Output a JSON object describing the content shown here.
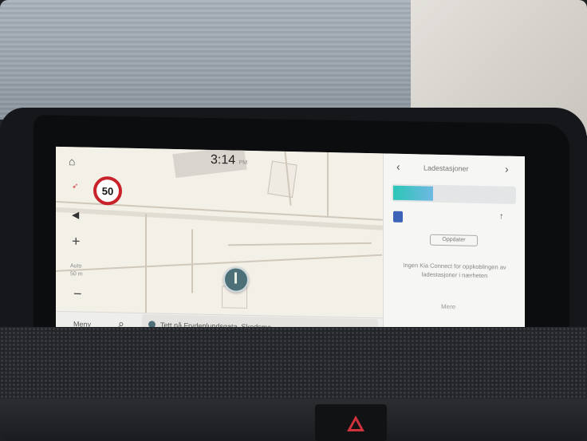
{
  "map": {
    "time": "3:14",
    "time_suffix": "PM",
    "speed_limit": "50",
    "zoom_mode": "Auto",
    "zoom_scale": "50 m",
    "menu_label": "Meny",
    "destination_text": "Tett på Frydenlundsgata, Skedsmo"
  },
  "panel": {
    "title": "Ladestasjoner",
    "button_label": "Oppdater",
    "message": "Ingen Kia Connect for oppkoblingen av ladestasjoner i nærheten",
    "footer_label": "Mere"
  },
  "colors": {
    "speed_ring": "#c8232b",
    "battery_start": "#2bc6b6",
    "battery_end": "#6fb8e3",
    "poi": "#4c6f78",
    "hazard": "#d0333c"
  },
  "battery_level": 0.32
}
